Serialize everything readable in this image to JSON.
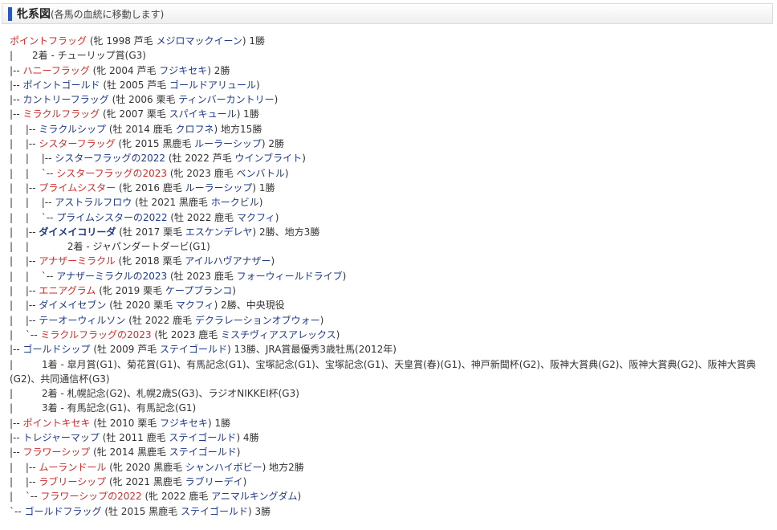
{
  "header": {
    "title": "牝系図",
    "subtitle": "(各馬の血統に移動します)"
  },
  "tree": [
    {
      "prefix": "",
      "name": "ポイントフラッグ",
      "meta": " (牝 1998 芦毛 ",
      "sire": "メジロマックイーン",
      "tail": ") 1勝",
      "name_color": "red"
    },
    {
      "prefix": "|　　",
      "text": "2着 - チューリップ賞(G3)"
    },
    {
      "prefix": "|-- ",
      "name": "ハニーフラッグ",
      "meta": " (牝 2004 芦毛 ",
      "sire": "フジキセキ",
      "tail": ") 2勝",
      "name_color": "red"
    },
    {
      "prefix": "|-- ",
      "name": "ポイントゴールド",
      "meta": " (牡 2005 芦毛 ",
      "sire": "ゴールドアリュール",
      "tail": ")",
      "name_color": "blue"
    },
    {
      "prefix": "|-- ",
      "name": "カントリーフラッグ",
      "meta": " (牡 2006 栗毛 ",
      "sire": "ティンバーカントリー",
      "tail": ")",
      "name_color": "blue"
    },
    {
      "prefix": "|-- ",
      "name": "ミラクルフラッグ",
      "meta": " (牝 2007 栗毛 ",
      "sire": "スパイキュール",
      "tail": ") 1勝",
      "name_color": "red"
    },
    {
      "prefix": "|　 |-- ",
      "name": "ミラクルシップ",
      "meta": " (牡 2014 鹿毛 ",
      "sire": "クロフネ",
      "tail": ") 地方15勝",
      "name_color": "blue"
    },
    {
      "prefix": "|　 |-- ",
      "name": "シスターフラッグ",
      "meta": " (牝 2015 黒鹿毛 ",
      "sire": "ルーラーシップ",
      "tail": ") 2勝",
      "name_color": "red"
    },
    {
      "prefix": "|　 |　 |-- ",
      "name": "シスターフラッグの2022",
      "meta": " (牡 2022 芦毛 ",
      "sire": "ウインブライト",
      "tail": ")",
      "name_color": "blue"
    },
    {
      "prefix": "|　 |　 `-- ",
      "name": "シスターフラッグの2023",
      "meta": " (牝 2023 鹿毛 ",
      "sire": "ベンバトル",
      "tail": ")",
      "name_color": "red"
    },
    {
      "prefix": "|　 |-- ",
      "name": "プライムシスター",
      "meta": " (牝 2016 鹿毛 ",
      "sire": "ルーラーシップ",
      "tail": ") 1勝",
      "name_color": "red"
    },
    {
      "prefix": "|　 |　 |-- ",
      "name": "アストラルフロウ",
      "meta": " (牡 2021 黒鹿毛 ",
      "sire": "ホークビル",
      "tail": ")",
      "name_color": "blue"
    },
    {
      "prefix": "|　 |　 `-- ",
      "name": "プライムシスターの2022",
      "meta": " (牡 2022 鹿毛 ",
      "sire": "マクフィ",
      "tail": ")",
      "name_color": "blue"
    },
    {
      "prefix": "|　 |-- ",
      "name": "ダイメイコリーダ",
      "meta": " (牡 2017 栗毛 ",
      "sire": "エスケンデレヤ",
      "tail": ") 2勝、地方3勝",
      "name_color": "bold"
    },
    {
      "prefix": "|　 |　　　　",
      "text": "2着 - ジャパンダートダービ(G1)"
    },
    {
      "prefix": "|　 |-- ",
      "name": "アナザーミラクル",
      "meta": " (牝 2018 栗毛 ",
      "sire": "アイルハヴアナザー",
      "tail": ")",
      "name_color": "red"
    },
    {
      "prefix": "|　 |　 `-- ",
      "name": "アナザーミラクルの2023",
      "meta": " (牡 2023 鹿毛 ",
      "sire": "フォーウィールドライブ",
      "tail": ")",
      "name_color": "blue"
    },
    {
      "prefix": "|　 |-- ",
      "name": "エニアグラム",
      "meta": " (牝 2019 栗毛 ",
      "sire": "ケープブランコ",
      "tail": ")",
      "name_color": "red"
    },
    {
      "prefix": "|　 |-- ",
      "name": "ダイメイセブン",
      "meta": " (牡 2020 栗毛 ",
      "sire": "マクフィ",
      "tail": ") 2勝、中央現役",
      "name_color": "blue"
    },
    {
      "prefix": "|　 |-- ",
      "name": "テーオーウィルソン",
      "meta": " (牡 2022 鹿毛 ",
      "sire": "デクラレーションオブウォー",
      "tail": ")",
      "name_color": "blue"
    },
    {
      "prefix": "|　 `-- ",
      "name": "ミラクルフラッグの2023",
      "meta": " (牝 2023 鹿毛 ",
      "sire": "ミスチヴィアスアレックス",
      "tail": ")",
      "name_color": "red"
    },
    {
      "prefix": "|-- ",
      "name": "ゴールドシップ",
      "meta": " (牡 2009 芦毛 ",
      "sire": "ステイゴールド",
      "tail": ") 13勝、JRA賞最優秀3歳牡馬(2012年)",
      "name_color": "blue"
    },
    {
      "prefix": "|　　　",
      "text": "1着 - 皐月賞(G1)、菊花賞(G1)、有馬記念(G1)、宝塚記念(G1)、宝塚記念(G1)、天皇賞(春)(G1)、神戸新聞杯(G2)、阪神大賞典(G2)、阪神大賞典(G2)、阪神大賞典(G2)、共同通信杯(G3)",
      "wrap": true
    },
    {
      "prefix": "|　　　",
      "text": "2着 - 札幌記念(G2)、札幌2歳S(G3)、ラジオNIKKEI杯(G3)"
    },
    {
      "prefix": "|　　　",
      "text": "3着 - 有馬記念(G1)、有馬記念(G1)"
    },
    {
      "prefix": "|-- ",
      "name": "ポイントキセキ",
      "meta": " (牡 2010 栗毛 ",
      "sire": "フジキセキ",
      "tail": ") 1勝",
      "name_color": "red"
    },
    {
      "prefix": "|-- ",
      "name": "トレジャーマップ",
      "meta": " (牡 2011 鹿毛 ",
      "sire": "ステイゴールド",
      "tail": ") 4勝",
      "name_color": "blue"
    },
    {
      "prefix": "|-- ",
      "name": "フラワーシップ",
      "meta": " (牝 2014 黒鹿毛 ",
      "sire": "ステイゴールド",
      "tail": ")",
      "name_color": "red"
    },
    {
      "prefix": "|　 |-- ",
      "name": "ムーランドール",
      "meta": " (牝 2020 黒鹿毛 ",
      "sire": "シャンハイボビー",
      "tail": ") 地方2勝",
      "name_color": "red"
    },
    {
      "prefix": "|　 |-- ",
      "name": "ラブリーシップ",
      "meta": " (牝 2021 黒鹿毛 ",
      "sire": "ラブリーデイ",
      "tail": ")",
      "name_color": "red"
    },
    {
      "prefix": "|　 `-- ",
      "name": "フラワーシップの2022",
      "meta": " (牝 2022 鹿毛 ",
      "sire": "アニマルキングダム",
      "tail": ")",
      "name_color": "red"
    },
    {
      "prefix": "`-- ",
      "name": "ゴールドフラッグ",
      "meta": " (牡 2015 黒鹿毛 ",
      "sire": "ステイゴールド",
      "tail": ") 3勝",
      "name_color": "blue"
    }
  ],
  "colors": {
    "red": "#d22b2b",
    "blue": "#1f3a8a",
    "accent_bar": "#2a55c4"
  }
}
